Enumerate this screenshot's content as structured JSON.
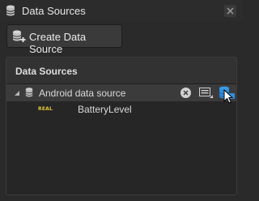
{
  "window": {
    "title": "Data Sources",
    "icons": {
      "title": "database-icon",
      "close": "close-icon"
    }
  },
  "toolbar": {
    "create_label": "Create Data Source",
    "create_icon": "database-add-icon"
  },
  "panel": {
    "header": "Data Sources",
    "tree": [
      {
        "label": "Android data source",
        "icon": "database-icon",
        "expanded": true,
        "actions": [
          "clear-icon",
          "card-icon",
          "database-import-icon"
        ],
        "children": [
          {
            "type_badge": "REAL",
            "label": "BatteryLevel"
          }
        ]
      }
    ]
  },
  "colors": {
    "background": "#2a2a2a",
    "panel": "#262626",
    "selected_row": "#3b3b3b",
    "accent_blue": "#2f8fe0",
    "badge_yellow": "#e2c83a"
  }
}
